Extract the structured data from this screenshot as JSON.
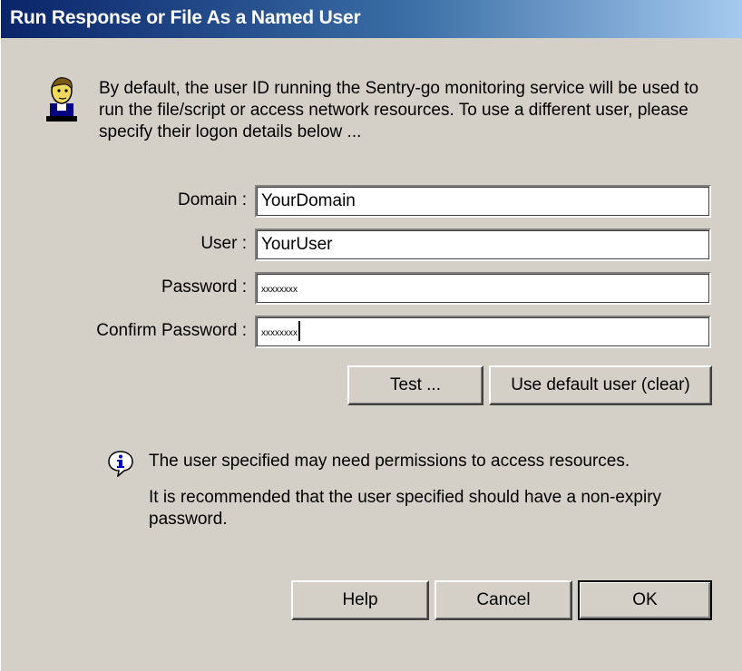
{
  "window": {
    "title": "Run Response or File As a Named User"
  },
  "intro": {
    "text": "By default, the user ID running the Sentry-go monitoring service will be used to run the file/script or access network resources. To use a different user, please specify their logon details below ..."
  },
  "form": {
    "domain": {
      "label": "Domain :",
      "value": "YourDomain"
    },
    "user": {
      "label": "User :",
      "value": "YourUser"
    },
    "password": {
      "label": "Password :",
      "value": "xxxxxxxx"
    },
    "confirm_password": {
      "label": "Confirm Password :",
      "value": "xxxxxxxx"
    }
  },
  "actions": {
    "test_label": "Test ...",
    "default_user_label": "Use default user (clear)"
  },
  "info": {
    "line1": "The user specified may need permissions to access resources.",
    "line2": "It is recommended that the user specified should have a non-expiry password."
  },
  "footer": {
    "help_label": "Help",
    "cancel_label": "Cancel",
    "ok_label": "OK"
  },
  "icons": {
    "user": "user-icon",
    "info": "info-icon"
  },
  "colors": {
    "title_gradient_start": "#0a246a",
    "title_gradient_end": "#a6caf0",
    "dialog_bg": "#d4d0c8"
  }
}
